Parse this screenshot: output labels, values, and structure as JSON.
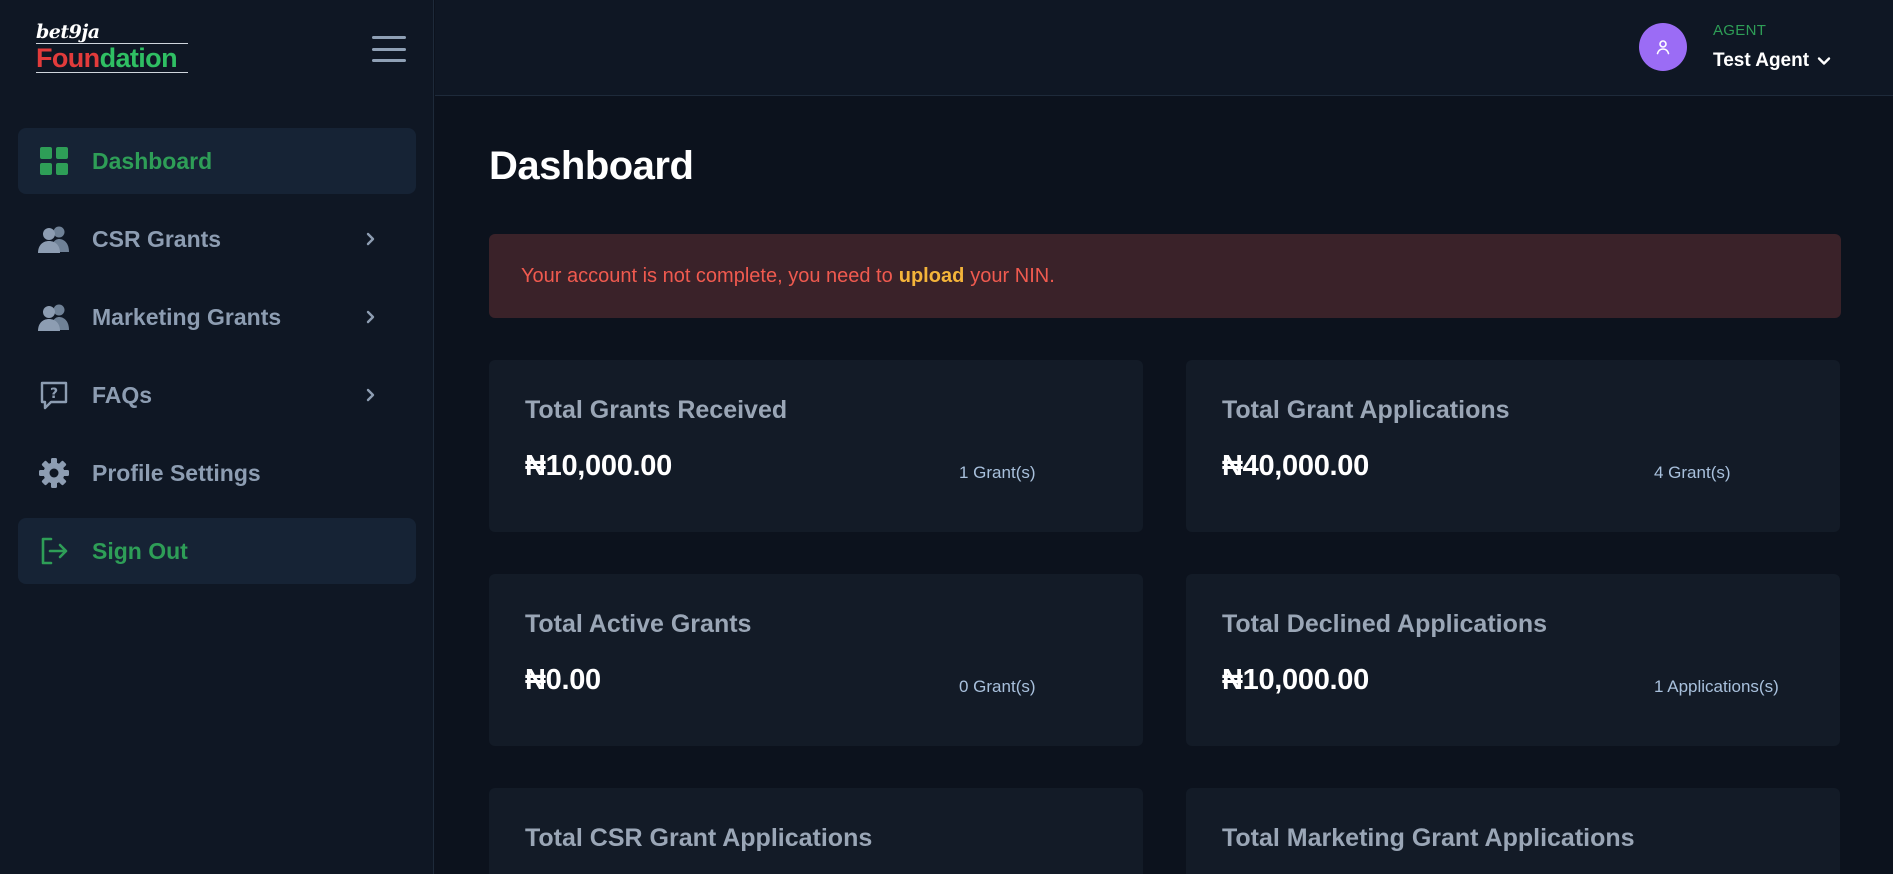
{
  "sidebar": {
    "logo": {
      "top": "bet9ja",
      "bottom_red": "Foun",
      "bottom_green": "dation"
    },
    "items": [
      {
        "label": "Dashboard",
        "icon": "grid-icon",
        "active": true
      },
      {
        "label": "CSR Grants",
        "icon": "users-icon",
        "chevron": true
      },
      {
        "label": "Marketing Grants",
        "icon": "users-icon",
        "chevron": true
      },
      {
        "label": "FAQs",
        "icon": "help-chat-icon",
        "chevron": true
      },
      {
        "label": "Profile Settings",
        "icon": "gear-icon"
      },
      {
        "label": "Sign Out",
        "icon": "sign-out-icon",
        "active": true
      }
    ]
  },
  "header": {
    "role": "AGENT",
    "user_name": "Test Agent"
  },
  "main": {
    "title": "Dashboard",
    "alert": {
      "before": "Your account is not complete, you need to",
      "link": "upload",
      "after": "your NIN."
    },
    "cards": [
      {
        "title": "Total Grants Received",
        "amount": "₦10,000.00",
        "count": "1 Grant(s)"
      },
      {
        "title": "Total Grant Applications",
        "amount": "₦40,000.00",
        "count": "4 Grant(s)"
      },
      {
        "title": "Total Active Grants",
        "amount": "₦0.00",
        "count": "0 Grant(s)"
      },
      {
        "title": "Total Declined Applications",
        "amount": "₦10,000.00",
        "count": "1 Applications(s)"
      },
      {
        "title": "Total CSR Grant Applications",
        "amount": "",
        "count": ""
      },
      {
        "title": "Total Marketing Grant Applications",
        "amount": "",
        "count": ""
      }
    ]
  },
  "colors": {
    "accent_green": "#2e9e57",
    "alert_red": "#f05a4f",
    "alert_link": "#f4b43a",
    "avatar": "#9b6cf5"
  }
}
